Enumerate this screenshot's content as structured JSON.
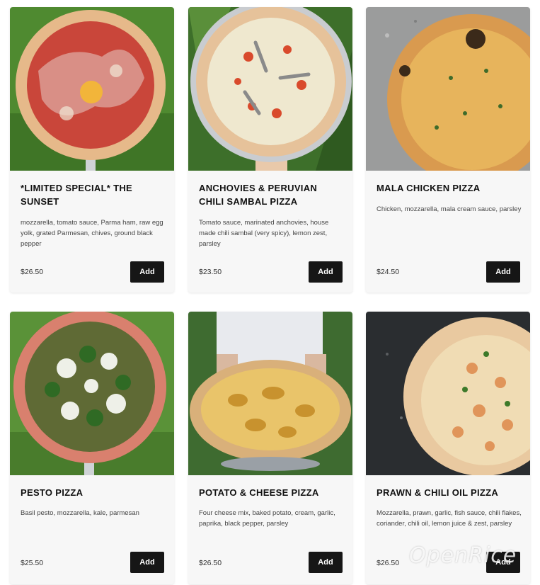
{
  "menu": {
    "items": [
      {
        "name": "*LIMITED SPECIAL* THE SUNSET",
        "description": "mozzarella, tomato sauce, Parma ham, raw egg yolk, grated Parmesan, chives, ground black pepper",
        "price": "$26.50",
        "add_label": "Add"
      },
      {
        "name": "ANCHOVIES & PERUVIAN CHILI SAMBAL PIZZA",
        "description": "Tomato sauce, marinated anchovies, house made chili sambal (very spicy), lemon zest, parsley",
        "price": "$23.50",
        "add_label": "Add"
      },
      {
        "name": "MALA CHICKEN PIZZA",
        "description": "Chicken, mozzarella, mala cream sauce, parsley",
        "price": "$24.50",
        "add_label": "Add"
      },
      {
        "name": "PESTO PIZZA",
        "description": "Basil pesto, mozzarella, kale, parmesan",
        "price": "$25.50",
        "add_label": "Add"
      },
      {
        "name": "POTATO & CHEESE PIZZA",
        "description": "Four cheese mix, baked potato, cream, garlic, paprika, black pepper, parsley",
        "price": "$26.50",
        "add_label": "Add"
      },
      {
        "name": "PRAWN & CHILI OIL PIZZA",
        "description": "Mozzarella, prawn, garlic, fish sauce, chili flakes, coriander, chili oil, lemon juice & zest, parsley",
        "price": "$26.50",
        "add_label": "Add"
      }
    ]
  },
  "watermark": "OpenRice",
  "colors": {
    "card_bg": "#f7f7f7",
    "button_bg": "#161616",
    "button_text": "#ffffff",
    "grass": "#4a8a2e",
    "crust": "#e3b77c"
  }
}
